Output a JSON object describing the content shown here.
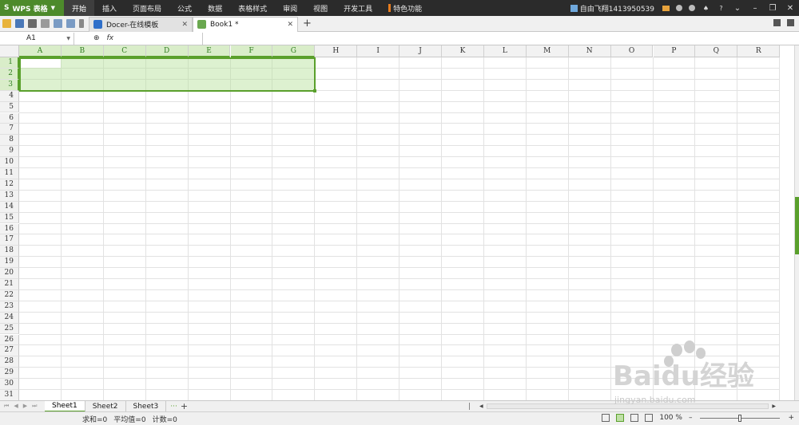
{
  "app": {
    "logo_label": "WPS 表格",
    "logo_letter": "S"
  },
  "menu": {
    "items": [
      "开始",
      "插入",
      "页面布局",
      "公式",
      "数据",
      "表格样式",
      "审阅",
      "视图",
      "开发工具",
      "特色功能"
    ],
    "active_index": 0
  },
  "user": {
    "name": "自由飞翔1413950539"
  },
  "tabs": {
    "items": [
      {
        "label": "Docer-在线模板",
        "icon": "docer-icon",
        "active": false
      },
      {
        "label": "Book1 *",
        "icon": "spreadsheet-icon",
        "active": true
      }
    ]
  },
  "formula_bar": {
    "name_box": "A1",
    "fx_label": "fx",
    "formula_value": ""
  },
  "grid": {
    "columns": [
      "A",
      "B",
      "C",
      "D",
      "E",
      "F",
      "G",
      "H",
      "I",
      "J",
      "K",
      "L",
      "M",
      "N",
      "O",
      "P",
      "Q",
      "R"
    ],
    "rows": [
      "1",
      "2",
      "3",
      "4",
      "5",
      "6",
      "7",
      "8",
      "9",
      "10",
      "11",
      "12",
      "13",
      "14",
      "15",
      "16",
      "17",
      "18",
      "19",
      "20",
      "21",
      "22",
      "23",
      "24",
      "25",
      "26",
      "27",
      "28",
      "29",
      "30",
      "31"
    ],
    "selection": "A1:G3",
    "selected_columns": [
      "A",
      "B",
      "C",
      "D",
      "E",
      "F",
      "G"
    ],
    "selected_rows": [
      "1",
      "2",
      "3"
    ],
    "accent_color": "#5aa02c"
  },
  "sheets": {
    "tabs": [
      "Sheet1",
      "Sheet2",
      "Sheet3"
    ],
    "active": "Sheet1",
    "more": "···",
    "add": "+"
  },
  "status": {
    "sum": "求和=0",
    "avg": "平均值=0",
    "count": "计数=0",
    "zoom": "100 %",
    "zoom_level_percent": 100
  },
  "watermark": {
    "brand": "Baidu经验",
    "url": "jingyan.baidu.com"
  }
}
